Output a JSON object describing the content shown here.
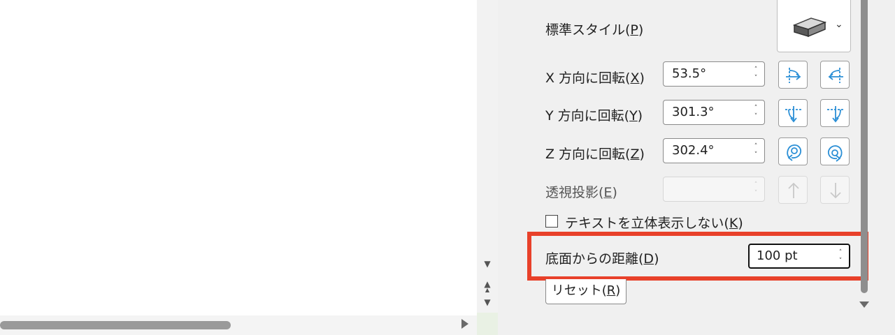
{
  "pane": {
    "preset": {
      "label_main": "標準スタイル(",
      "label_key": "P",
      "label_end": ")",
      "chevron": "⌄",
      "icon": "3d-block-icon"
    },
    "rotation_x": {
      "label_main": "X 方向に回転(",
      "label_key": "X",
      "label_end": ")",
      "value": "53.5°"
    },
    "rotation_y": {
      "label_main": "Y 方向に回転(",
      "label_key": "Y",
      "label_end": ")",
      "value": "301.3°"
    },
    "rotation_z": {
      "label_main": "Z 方向に回転(",
      "label_key": "Z",
      "label_end": ")",
      "value": "302.4°"
    },
    "perspective": {
      "label_main": "透視投影(",
      "label_key": "E",
      "label_end": ")",
      "value": ""
    },
    "keep_text_flat": {
      "label_main": "テキストを立体表示しない(",
      "label_key": "K",
      "label_end": ")",
      "checked": false
    },
    "distance": {
      "label_main": "底面からの距離(",
      "label_key": "D",
      "label_end": ")",
      "value": "100 pt"
    },
    "reset": {
      "label_main": "リセット(",
      "label_key": "R",
      "label_end": ")"
    },
    "spin_up": "˄",
    "spin_down": "˅"
  },
  "colors": {
    "highlight": "#e8412a",
    "icon_blue": "#2b8fd6"
  }
}
